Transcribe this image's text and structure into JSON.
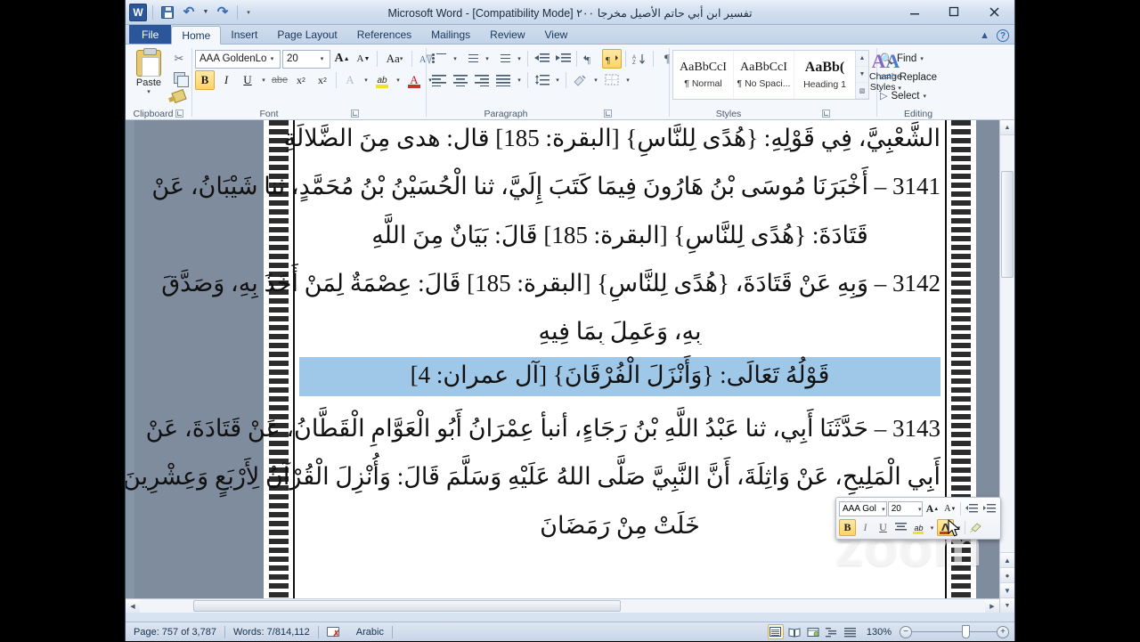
{
  "window": {
    "title": "تفسير ابن أبي حاتم الأصيل مخرجا ٢٠٠ [Compatibility Mode]  -  Microsoft Word",
    "app_logo": "W",
    "minimize": "minimize-icon",
    "restore": "restore-icon",
    "close": "close-icon"
  },
  "quick_access": {
    "save": "save-icon",
    "undo": "undo-icon",
    "redo": "redo-icon",
    "customize": "customize-qat-icon"
  },
  "tabs": [
    {
      "label": "File",
      "active": false,
      "file": true
    },
    {
      "label": "Home",
      "active": true
    },
    {
      "label": "Insert",
      "active": false
    },
    {
      "label": "Page Layout",
      "active": false
    },
    {
      "label": "References",
      "active": false
    },
    {
      "label": "Mailings",
      "active": false
    },
    {
      "label": "Review",
      "active": false
    },
    {
      "label": "View",
      "active": false
    }
  ],
  "ribbon": {
    "clipboard": {
      "group_label": "Clipboard",
      "paste_label": "Paste",
      "cut": "scissors-icon",
      "copy": "copy-icon",
      "format_painter": "format-painter-icon"
    },
    "font": {
      "group_label": "Font",
      "font_name": "AAA GoldenLot",
      "font_size": "20",
      "grow_font": "A",
      "shrink_font": "A",
      "change_case": "Aa",
      "clear_formatting": "clear-formatting-icon",
      "bold": "B",
      "italic": "I",
      "underline": "U",
      "strikethrough": "abe",
      "subscript": "x",
      "superscript": "x",
      "text_effects": "A",
      "highlight": "ab",
      "font_color": "A",
      "font_color_value": "#c0392b",
      "highlight_color_value": "#f2e12a"
    },
    "paragraph": {
      "group_label": "Paragraph",
      "bullets": "bullets-icon",
      "numbering": "numbering-icon",
      "multilevel": "multilevel-list-icon",
      "decrease_indent": "decrease-indent-icon",
      "increase_indent": "increase-indent-icon",
      "ltr": "left-to-right-icon",
      "rtl": "right-to-left-icon",
      "rtl_active": true,
      "sort": "sort-icon",
      "show_marks": "¶",
      "align_left": "align-left-icon",
      "align_center": "align-center-icon",
      "align_right": "align-right-icon",
      "justify": "justify-icon",
      "line_spacing": "line-spacing-icon",
      "shading": "shading-icon",
      "borders": "borders-icon"
    },
    "styles": {
      "group_label": "Styles",
      "items": [
        {
          "preview": "AaBbCcI",
          "label": "¶ Normal",
          "heading": false
        },
        {
          "preview": "AaBbCcI",
          "label": "¶ No Spaci...",
          "heading": false
        },
        {
          "preview": "AaBb(",
          "label": "Heading 1",
          "heading": true
        }
      ],
      "change_styles_label": "Change\nStyles"
    },
    "editing": {
      "group_label": "Editing",
      "find": "Find",
      "replace": "Replace",
      "select": "Select"
    }
  },
  "document": {
    "lines": [
      {
        "text": "الشَّعْبِيَّ، فِي قَوْلِهِ: {هُدًى لِلنَّاسِ} [البقرة: 185] قال: هدى مِنَ الضَّلالَةِ",
        "selected": false
      },
      {
        "text": "3141 – أَخْبَرَنَا مُوسَى بْنُ هَارُونَ فِيمَا كَتَبَ إِلَيَّ، ثنا الْحُسَيْنُ بْنُ مُحَمَّدٍ، ثنا شَيْبَانُ، عَنْ",
        "selected": false
      },
      {
        "text": "قَتَادَةَ: {هُدًى لِلنَّاسِ} [البقرة: 185] قَالَ: بَيَانٌ مِنَ اللَّهِ",
        "selected": false
      },
      {
        "text": "3142 – وَبِهِ عَنْ قَتَادَةَ، {هُدًى لِلنَّاسِ} [البقرة: 185] قَالَ: عِصْمَةٌ لِمَنْ أَخَذَ بِهِ، وَصَدَّقَ",
        "selected": false
      },
      {
        "text": "بِهِ، وَعَمِلَ بِمَا فِيهِ",
        "selected": false
      },
      {
        "text": "قَوْلُهُ تَعَالَى: {وَأَنْزَلَ الْفُرْقَانَ} [آل عمران: 4]",
        "selected": true
      },
      {
        "text": "3143 – حَدَّثَنَا أَبِي، ثنا عَبْدُ اللَّهِ بْنُ رَجَاءٍ، أنبأ عِمْرَانُ أَبُو الْعَوَّامِ الْقَطَّانُ، عَنْ قَتَادَةَ، عَنْ",
        "selected": false
      },
      {
        "text": "أَبِي الْمَلِيحِ، عَنْ وَاثِلَةَ، أَنَّ النَّبِيَّ صَلَّى اللهُ عَلَيْهِ وَسَلَّمَ قَالَ: وَأُنْزِلَ الْقُرْآنُ لِأَرْبَعٍ وَعِشْرِينَ",
        "selected": false
      },
      {
        "text": "خَلَتْ مِنْ رَمَضَانَ",
        "selected": false
      }
    ]
  },
  "mini_toolbar": {
    "font_name": "AAA Gol",
    "font_size": "20",
    "grow_font": "A",
    "shrink_font": "A",
    "decrease_indent": "decrease-indent-icon",
    "increase_indent": "increase-indent-icon",
    "bold": "B",
    "italic": "I",
    "underline": "U",
    "align_center": "align-center-icon",
    "highlight": "ab",
    "font_color": "font-color-icon",
    "format_painter": "format-painter-icon"
  },
  "status_bar": {
    "page": "Page: 757 of 3,787",
    "words": "Words: 7/814,112",
    "proofing": "proofing-errors-icon",
    "language": "Arabic",
    "views": [
      "print-layout-view",
      "full-screen-reading-view",
      "web-layout-view",
      "outline-view",
      "draft-view"
    ],
    "zoom": "130%",
    "zoom_out": "−",
    "zoom_in": "+"
  },
  "watermark": {
    "text": "zoom"
  }
}
